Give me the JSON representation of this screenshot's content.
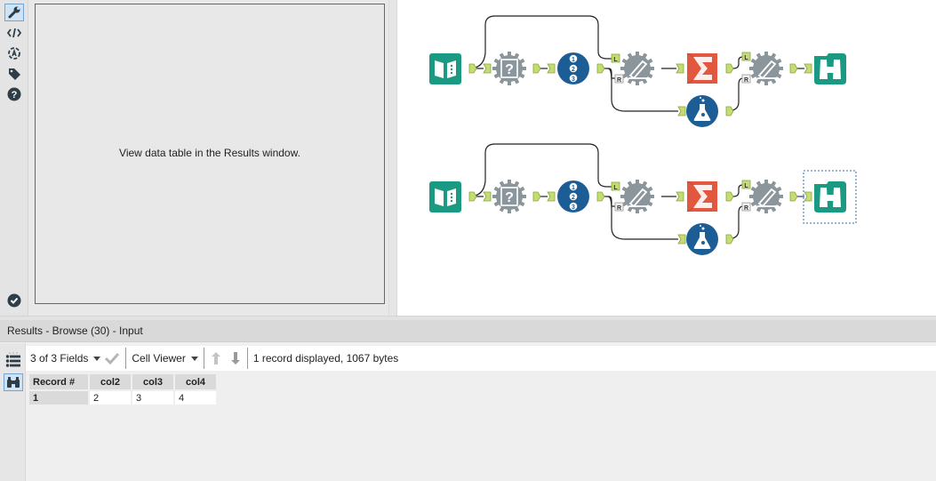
{
  "config_panel": {
    "icons": [
      {
        "name": "wrench-icon",
        "label": "Configuration",
        "active": true
      },
      {
        "name": "code-icon",
        "label": "XML"
      },
      {
        "name": "annotation-icon",
        "label": "Annotation"
      },
      {
        "name": "tag-icon",
        "label": "Meta Info"
      },
      {
        "name": "help-icon",
        "label": "Help"
      }
    ],
    "bottom_icon": "check-circle-icon",
    "message": "View data table in the Results window."
  },
  "canvas": {
    "workflows": [
      {
        "tools": [
          {
            "type": "input-data",
            "icon": "book-icon",
            "color": "#1a9a82"
          },
          {
            "type": "unknown-macro",
            "icon": "question-gear-icon",
            "color": "#8b969c"
          },
          {
            "type": "record-id",
            "icon": "numbered-123-icon",
            "color": "#1d5d96"
          },
          {
            "type": "join-macro",
            "icon": "pen-gear-icon",
            "color": "#8b969c"
          },
          {
            "type": "summarize",
            "icon": "sigma-icon",
            "color": "#e2583e"
          },
          {
            "type": "join-macro-2",
            "icon": "pen-gear-icon",
            "color": "#8b969c"
          },
          {
            "type": "browse",
            "icon": "binoculars-icon",
            "color": "#1a9a82"
          },
          {
            "type": "formula",
            "icon": "flask-icon",
            "color": "#1d5d96"
          }
        ],
        "anchor_labels": {
          "left": "L",
          "right": "R"
        },
        "selected_tool": null
      },
      {
        "tools": [
          {
            "type": "input-data",
            "icon": "book-icon",
            "color": "#1a9a82"
          },
          {
            "type": "unknown-macro",
            "icon": "question-gear-icon",
            "color": "#8b969c"
          },
          {
            "type": "record-id",
            "icon": "numbered-123-icon",
            "color": "#1d5d96"
          },
          {
            "type": "join-macro",
            "icon": "pen-gear-icon",
            "color": "#8b969c"
          },
          {
            "type": "summarize",
            "icon": "sigma-icon",
            "color": "#e2583e"
          },
          {
            "type": "join-macro-2",
            "icon": "pen-gear-icon",
            "color": "#8b969c"
          },
          {
            "type": "browse",
            "icon": "binoculars-icon",
            "color": "#1a9a82"
          },
          {
            "type": "formula",
            "icon": "flask-icon",
            "color": "#1d5d96"
          }
        ],
        "anchor_labels": {
          "left": "L",
          "right": "R"
        },
        "selected_tool": "browse"
      }
    ]
  },
  "results": {
    "title": "Results - Browse (30) - Input",
    "toolbar": {
      "fields_selector": "3 of 3 Fields",
      "viewer_selector": "Cell Viewer",
      "status": "1 record displayed, 1067 bytes"
    },
    "side_icons": [
      "list-icon",
      "binoculars-icon"
    ],
    "table": {
      "columns": [
        "Record #",
        "col2",
        "col3",
        "col4"
      ],
      "rows": [
        [
          "1",
          "2",
          "3",
          "4"
        ]
      ]
    }
  },
  "colors": {
    "teal": "#1a9a82",
    "navy": "#1d5d96",
    "gray_tool": "#8b969c",
    "orange": "#e2583e",
    "anchor": "#bfd86f",
    "selection": "#2f6fa8"
  }
}
